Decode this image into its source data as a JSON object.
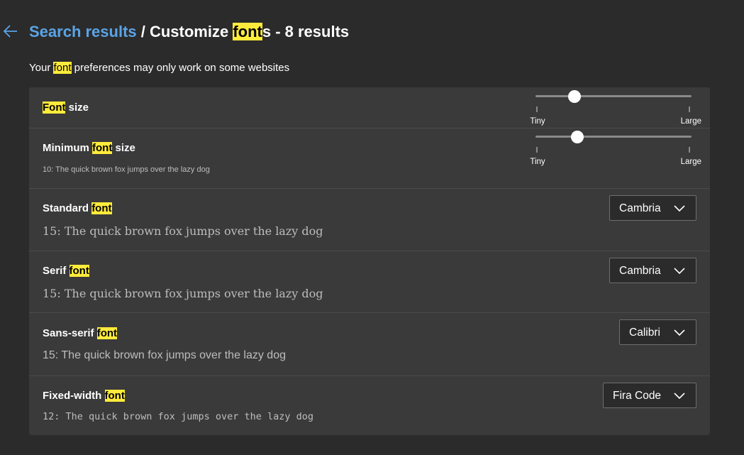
{
  "header": {
    "breadcrumb_link": "Search results",
    "title_prefix": " / Customize ",
    "title_highlight": "font",
    "title_suffix": "s - 8 results"
  },
  "subtitle": {
    "prefix": "Your ",
    "highlight": "font",
    "suffix": " preferences may only work on some websites"
  },
  "rows": [
    {
      "label_prefix": "",
      "label_highlight": "Font",
      "label_suffix": " size",
      "slider": {
        "min_label": "Tiny",
        "max_label": "Large",
        "level": 0.25
      }
    },
    {
      "label_prefix": "Minimum ",
      "label_highlight": "font",
      "label_suffix": " size",
      "sample": "10: The quick brown fox jumps over the lazy dog",
      "slider": {
        "min_label": "Tiny",
        "max_label": "Large",
        "level": 0.27
      }
    },
    {
      "label_prefix": "Standard ",
      "label_highlight": "font",
      "label_suffix": "",
      "sample": "15: The quick brown fox jumps over the lazy dog",
      "dropdown": "Cambria"
    },
    {
      "label_prefix": "Serif ",
      "label_highlight": "font",
      "label_suffix": "",
      "sample": "15: The quick brown fox jumps over the lazy dog",
      "dropdown": "Cambria"
    },
    {
      "label_prefix": "Sans-serif ",
      "label_highlight": "font",
      "label_suffix": "",
      "sample": "15: The quick brown fox jumps over the lazy dog",
      "dropdown": "Calibri"
    },
    {
      "label_prefix": "Fixed-width ",
      "label_highlight": "font",
      "label_suffix": "",
      "sample": "12: The quick brown fox jumps over the lazy dog",
      "dropdown": "Fira Code"
    }
  ],
  "colors": {
    "background": "#2b2b2b",
    "card": "#3a3a3a",
    "link": "#5ba4e6",
    "highlight": "#ffeb3b"
  },
  "icons": {
    "back": "arrow-left-icon",
    "dropdown": "chevron-down-icon"
  }
}
